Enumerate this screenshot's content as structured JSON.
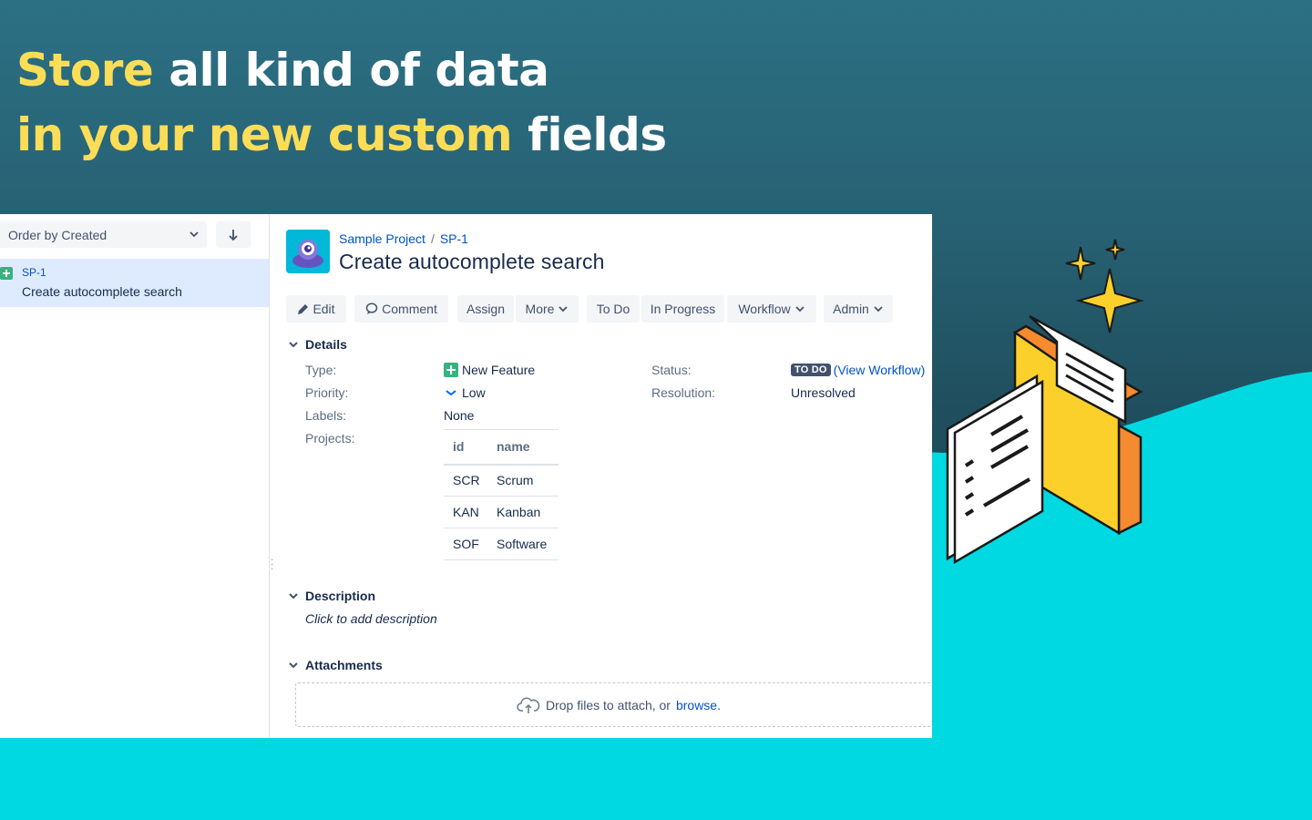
{
  "headline": {
    "line1_highlight": "Store",
    "line1_rest": " all kind of data",
    "line2_highlight": "in your new custom",
    "line2_rest": " fields"
  },
  "colors": {
    "headline_highlight": "#fcdd58",
    "background_top": "#2c7084",
    "wave": "#00d9e1",
    "accent_link": "#0052cc"
  },
  "sidebar": {
    "order_select": "Order by Created",
    "sort_icon": "arrow-down-icon",
    "issues": [
      {
        "key": "SP-1",
        "summary": "Create autocomplete search",
        "type_icon": "new-feature-icon"
      }
    ]
  },
  "issue": {
    "breadcrumb": {
      "project": "Sample Project",
      "separator": "/",
      "key": "SP-1"
    },
    "title": "Create autocomplete search",
    "toolbar": {
      "edit": "Edit",
      "comment": "Comment",
      "assign": "Assign",
      "more": "More",
      "todo": "To Do",
      "in_progress": "In Progress",
      "workflow": "Workflow",
      "admin": "Admin"
    },
    "details": {
      "heading": "Details",
      "type_label": "Type:",
      "type_value": "New Feature",
      "priority_label": "Priority:",
      "priority_value": "Low",
      "labels_label": "Labels:",
      "labels_value": "None",
      "projects_label": "Projects:",
      "status_label": "Status:",
      "status_badge": "TO DO",
      "status_link_open": "(",
      "status_link": "View Workflow",
      "status_link_close": ")",
      "resolution_label": "Resolution:",
      "resolution_value": "Unresolved"
    },
    "projects_table": {
      "headers": [
        "id",
        "name"
      ],
      "rows": [
        [
          "SCR",
          "Scrum"
        ],
        [
          "KAN",
          "Kanban"
        ],
        [
          "SOF",
          "Software"
        ]
      ]
    },
    "description": {
      "heading": "Description",
      "placeholder": "Click to add description"
    },
    "attachments": {
      "heading": "Attachments",
      "drop_text": "Drop files to attach, or",
      "browse": "browse."
    }
  }
}
